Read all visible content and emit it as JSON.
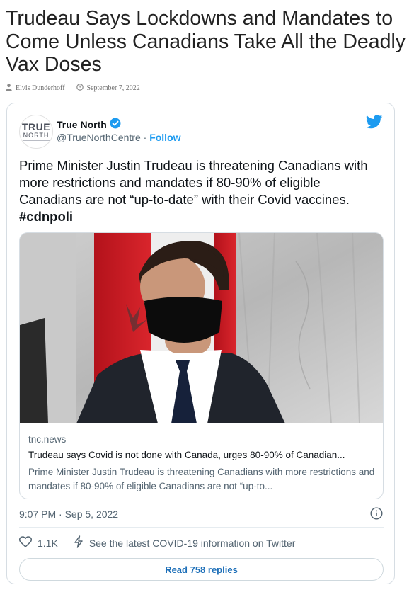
{
  "article": {
    "headline": "Trudeau Says Lockdowns and Mandates to Come Unless Canadians Take All the Deadly Vax Doses",
    "author": "Elvis Dunderhoff",
    "date": "September 7, 2022"
  },
  "tweet": {
    "avatar_line1": "TRUE",
    "avatar_line2": "NORTH",
    "display_name": "True North",
    "handle": "@TrueNorthCentre",
    "separator": "·",
    "follow_label": "Follow",
    "text": "Prime Minister Justin Trudeau is threatening Canadians with more restrictions and mandates if 80-90% of eligible Canadians are not “up-to-date” with their Covid vaccines.",
    "hashtag": "#cdnpoli",
    "link_card": {
      "domain": "tnc.news",
      "title": "Trudeau says Covid is not done with Canada, urges 80-90% of Canadian...",
      "description": "Prime Minister Justin Trudeau is threatening Canadians with more restrictions and mandates if 80-90% of eligible Canadians are not “up-to..."
    },
    "timestamp": "9:07 PM · Sep 5, 2022",
    "likes": "1.1K",
    "covid_info": "See the latest COVID-19 information on Twitter",
    "replies_label": "Read 758 replies"
  },
  "icons": {
    "author": "person-icon",
    "date": "clock-icon",
    "verified": "verified-badge-icon",
    "brand": "twitter-bird-icon",
    "info": "info-icon",
    "like": "heart-icon",
    "covid": "lightning-icon"
  },
  "colors": {
    "twitter_blue": "#1d9bf0",
    "text_dark": "#0f1419",
    "text_muted": "#536471",
    "border": "#d6dde3"
  }
}
